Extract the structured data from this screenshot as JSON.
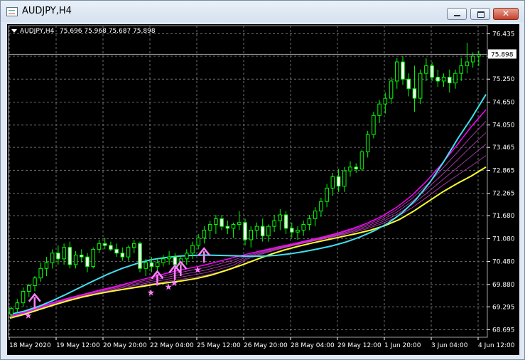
{
  "window": {
    "title": "AUDJPY,H4",
    "close_glyph": "✕"
  },
  "header": {
    "label": "AUDJPY,H4",
    "ohlc": "75.696 75.968 75.687 75.898"
  },
  "colors": {
    "background": "#000000",
    "grid": "#6e6e6e",
    "bull_body": "#00ff00",
    "bull_fill": "#000000",
    "bear_fill": "#ffffff",
    "cyan_ma": "#40e0f0",
    "yellow_ma": "#ffff30",
    "magenta_ma": "#ff00ff",
    "arrow": "#ff80ff",
    "axis_text": "#ffffff"
  },
  "chart_data": {
    "type": "candlestick",
    "symbol": "AUDJPY",
    "timeframe": "H4",
    "current_price": 75.898,
    "ylim": [
      68.5,
      76.65
    ],
    "y_ticks": [
      "76.435",
      "75.850",
      "75.250",
      "74.650",
      "74.050",
      "73.465",
      "72.865",
      "72.265",
      "71.680",
      "71.080",
      "70.480",
      "69.880",
      "69.295",
      "68.695"
    ],
    "x_ticks": [
      "18 May 2020",
      "19 May 12:00",
      "20 May 20:00",
      "22 May 04:00",
      "25 May 12:00",
      "26 May 20:00",
      "28 May 04:00",
      "29 May 12:00",
      "1 Jun 20:00",
      "3 Jun 04:00",
      "4 Jun 12:00"
    ],
    "candles": [
      [
        69.1,
        69.3,
        69.0,
        69.25
      ],
      [
        69.25,
        69.5,
        69.15,
        69.4
      ],
      [
        69.4,
        69.8,
        69.3,
        69.7
      ],
      [
        69.7,
        69.9,
        69.55,
        69.85
      ],
      [
        69.85,
        70.1,
        69.7,
        70.05
      ],
      [
        70.05,
        70.45,
        69.95,
        70.3
      ],
      [
        70.3,
        70.6,
        70.1,
        70.45
      ],
      [
        70.45,
        70.8,
        70.3,
        70.7
      ],
      [
        70.7,
        70.9,
        70.4,
        70.55
      ],
      [
        70.55,
        70.95,
        70.4,
        70.85
      ],
      [
        70.85,
        71.0,
        70.3,
        70.4
      ],
      [
        70.4,
        70.75,
        70.3,
        70.65
      ],
      [
        70.65,
        70.8,
        70.45,
        70.6
      ],
      [
        70.6,
        70.7,
        70.2,
        70.35
      ],
      [
        70.35,
        70.85,
        70.3,
        70.8
      ],
      [
        70.8,
        71.05,
        70.7,
        70.95
      ],
      [
        70.95,
        71.1,
        70.8,
        70.9
      ],
      [
        70.9,
        71.0,
        70.75,
        70.8
      ],
      [
        70.8,
        70.95,
        70.6,
        70.7
      ],
      [
        70.7,
        70.85,
        70.5,
        70.6
      ],
      [
        70.6,
        70.9,
        70.5,
        70.85
      ],
      [
        70.85,
        71.05,
        70.7,
        70.95
      ],
      [
        70.95,
        71.0,
        70.2,
        70.3
      ],
      [
        70.3,
        70.55,
        70.1,
        70.45
      ],
      [
        70.45,
        70.6,
        70.2,
        70.35
      ],
      [
        70.35,
        70.55,
        70.2,
        70.45
      ],
      [
        70.45,
        70.65,
        70.35,
        70.55
      ],
      [
        70.55,
        70.75,
        70.4,
        70.6
      ],
      [
        70.6,
        70.7,
        70.3,
        70.4
      ],
      [
        70.4,
        70.65,
        70.3,
        70.55
      ],
      [
        70.55,
        70.8,
        70.4,
        70.7
      ],
      [
        70.7,
        71.0,
        70.55,
        70.9
      ],
      [
        70.9,
        71.2,
        70.8,
        71.1
      ],
      [
        71.1,
        71.4,
        70.95,
        71.3
      ],
      [
        71.3,
        71.55,
        71.1,
        71.45
      ],
      [
        71.45,
        71.7,
        71.2,
        71.6
      ],
      [
        71.6,
        71.7,
        71.3,
        71.4
      ],
      [
        71.4,
        71.55,
        71.2,
        71.35
      ],
      [
        71.35,
        71.5,
        71.1,
        71.45
      ],
      [
        71.45,
        71.8,
        71.3,
        71.5
      ],
      [
        71.5,
        71.6,
        70.9,
        71.05
      ],
      [
        71.05,
        71.4,
        70.85,
        71.3
      ],
      [
        71.3,
        71.5,
        71.1,
        71.4
      ],
      [
        71.4,
        71.6,
        71.0,
        71.15
      ],
      [
        71.15,
        71.45,
        71.0,
        71.4
      ],
      [
        71.4,
        71.7,
        71.25,
        71.55
      ],
      [
        71.55,
        71.85,
        71.3,
        71.7
      ],
      [
        71.7,
        71.8,
        71.2,
        71.35
      ],
      [
        71.35,
        71.5,
        71.1,
        71.25
      ],
      [
        71.25,
        71.4,
        71.05,
        71.3
      ],
      [
        71.3,
        71.55,
        71.15,
        71.45
      ],
      [
        71.45,
        71.7,
        71.3,
        71.6
      ],
      [
        71.6,
        71.9,
        71.4,
        71.8
      ],
      [
        71.8,
        72.15,
        71.65,
        72.05
      ],
      [
        72.05,
        72.5,
        71.9,
        72.4
      ],
      [
        72.4,
        72.8,
        72.2,
        72.7
      ],
      [
        72.7,
        72.9,
        72.3,
        72.45
      ],
      [
        72.45,
        72.95,
        72.3,
        72.85
      ],
      [
        72.85,
        73.1,
        72.7,
        72.95
      ],
      [
        72.95,
        73.05,
        72.8,
        72.9
      ],
      [
        72.9,
        73.4,
        72.85,
        73.35
      ],
      [
        73.35,
        73.9,
        73.2,
        73.8
      ],
      [
        73.8,
        74.4,
        73.7,
        74.3
      ],
      [
        74.3,
        74.7,
        74.1,
        74.6
      ],
      [
        74.6,
        74.9,
        74.35,
        74.75
      ],
      [
        74.75,
        75.3,
        74.6,
        75.2
      ],
      [
        75.2,
        75.8,
        75.0,
        75.7
      ],
      [
        75.7,
        75.85,
        75.1,
        75.25
      ],
      [
        75.25,
        75.4,
        74.8,
        75.0
      ],
      [
        75.0,
        75.6,
        74.4,
        74.75
      ],
      [
        74.75,
        75.5,
        74.6,
        75.4
      ],
      [
        75.4,
        75.8,
        75.2,
        75.6
      ],
      [
        75.6,
        75.7,
        75.2,
        75.3
      ],
      [
        75.3,
        75.5,
        75.05,
        75.2
      ],
      [
        75.2,
        75.4,
        75.05,
        75.3
      ],
      [
        75.3,
        75.5,
        74.9,
        75.15
      ],
      [
        75.15,
        75.5,
        75.0,
        75.4
      ],
      [
        75.4,
        75.8,
        75.2,
        75.6
      ],
      [
        75.6,
        76.2,
        75.4,
        75.7
      ],
      [
        75.7,
        75.95,
        75.55,
        75.85
      ],
      [
        75.85,
        76.0,
        75.6,
        75.898
      ]
    ],
    "ma_series": [
      {
        "role": "cyan",
        "values": [
          69.1,
          69.18,
          69.3,
          69.45,
          69.62,
          69.8,
          69.98,
          70.15,
          70.3,
          70.42,
          70.52,
          70.58,
          70.62,
          70.64,
          70.65,
          70.64,
          70.63,
          70.62,
          70.62,
          70.64,
          70.68,
          70.74,
          70.81,
          70.89,
          70.99,
          71.12,
          71.28,
          71.48,
          71.75,
          72.1,
          72.55,
          73.1,
          73.7,
          74.25,
          74.85
        ]
      },
      {
        "role": "yellow",
        "values": [
          69.0,
          69.1,
          69.22,
          69.34,
          69.45,
          69.55,
          69.63,
          69.7,
          69.76,
          69.82,
          69.88,
          69.93,
          69.98,
          70.04,
          70.13,
          70.25,
          70.38,
          70.52,
          70.66,
          70.78,
          70.88,
          70.97,
          71.05,
          71.13,
          71.21,
          71.3,
          71.42,
          71.58,
          71.8,
          72.05,
          72.3,
          72.52,
          72.72,
          72.95
        ]
      },
      {
        "role": "magenta",
        "values": [
          69.05,
          69.15,
          69.3,
          69.42,
          69.53,
          69.63,
          69.73,
          69.82,
          69.92,
          70.02,
          70.12,
          70.22,
          70.3,
          70.38,
          70.48,
          70.58,
          70.68,
          70.77,
          70.86,
          70.94,
          71.03,
          71.12,
          71.22,
          71.34,
          71.48,
          71.66,
          71.9,
          72.2,
          72.58,
          73.02,
          73.5,
          74.0,
          74.45
        ]
      }
    ],
    "arrow_signals": [
      {
        "x_index": 3,
        "price": 69.25
      },
      {
        "x_index": 24,
        "price": 69.85
      },
      {
        "x_index": 27,
        "price": 70.0
      },
      {
        "x_index": 28,
        "price": 70.1
      },
      {
        "x_index": 32,
        "price": 70.45
      }
    ]
  }
}
